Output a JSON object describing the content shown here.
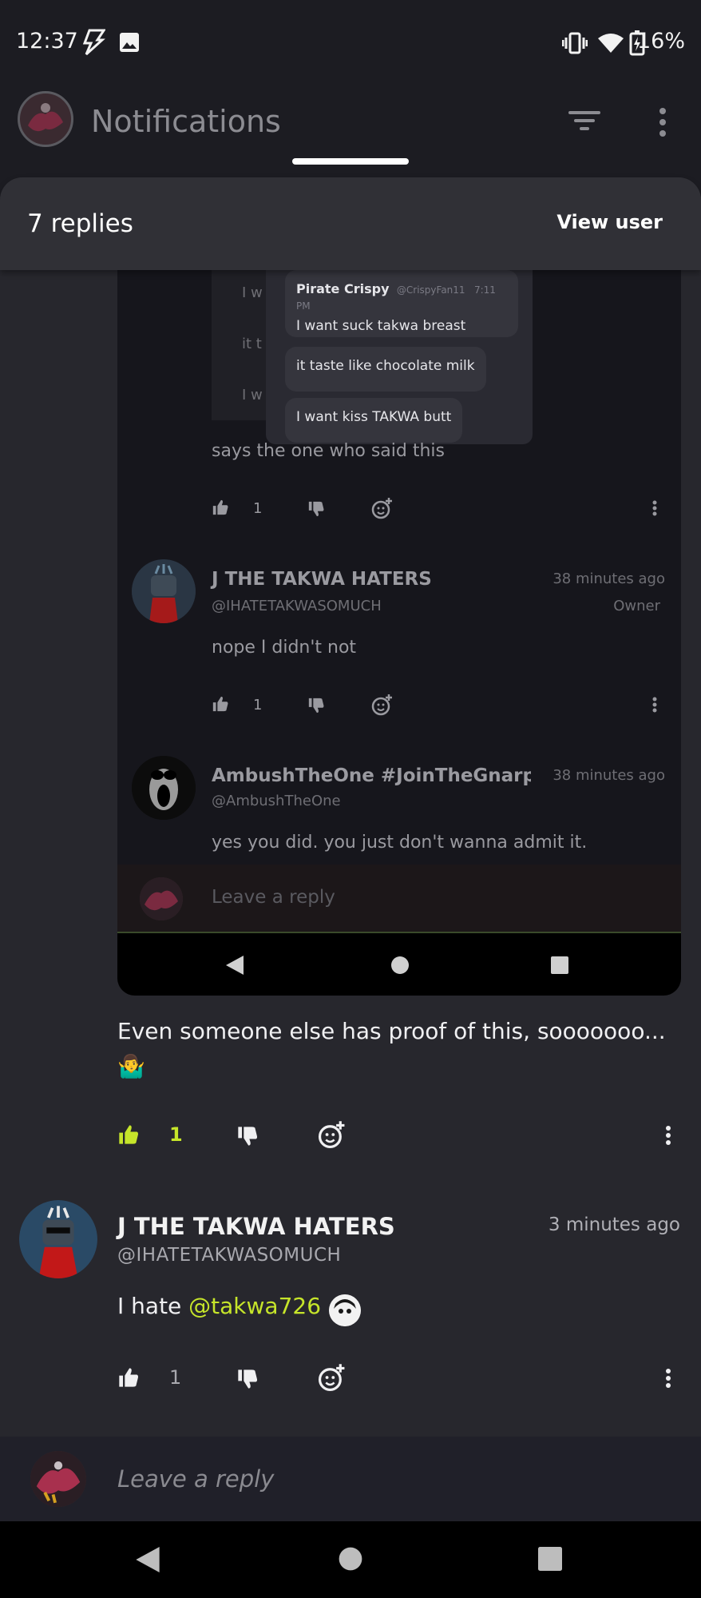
{
  "status_bar": {
    "time": "12:37",
    "battery": "16%"
  },
  "topbar": {
    "title": "Notifications"
  },
  "sheet": {
    "title": "7 replies",
    "view_user": "View user"
  },
  "embedded": {
    "bubble_author": "Pirate Crispy",
    "bubble_handle": "@CrispyFan11",
    "bubble_time": "7:11 PM",
    "bubble_messages": [
      "I want suck takwa breast",
      "it taste like chocolate milk",
      "I want kiss TAKWA butt"
    ],
    "left_fragments": [
      "I w",
      "it t",
      "I w"
    ],
    "comments": [
      {
        "text": "says the one who said this",
        "likes": "1"
      },
      {
        "name": "J THE TAKWA HATERS",
        "handle": "@IHATETAKWASOMUCH",
        "time": "38 minutes ago",
        "badge": "Owner",
        "text": "nope I didn't not",
        "likes": "1"
      },
      {
        "name": "AmbushTheOne #JoinTheGnarpCu",
        "handle": "@AmbushTheOne",
        "time": "38 minutes ago",
        "text": "yes you did. you just don't wanna admit it."
      }
    ],
    "reply_placeholder": "Leave a reply"
  },
  "comment_1": {
    "text": "Even someone else has proof of this, sooooooo...",
    "emoji": "🤷‍♂️",
    "likes": "1",
    "liked_color": "#c6e52a"
  },
  "comment_2": {
    "name": "J THE TAKWA HATERS",
    "handle": "@IHATETAKWASOMUCH",
    "time": "3 minutes ago",
    "text_prefix": "I hate ",
    "mention": "@takwa726",
    "likes": "1"
  },
  "reply_bar": {
    "placeholder": "Leave a reply"
  },
  "colors": {
    "accent": "#c6e52a",
    "sheet_bg": "#27272d",
    "header_bg": "#303036"
  }
}
